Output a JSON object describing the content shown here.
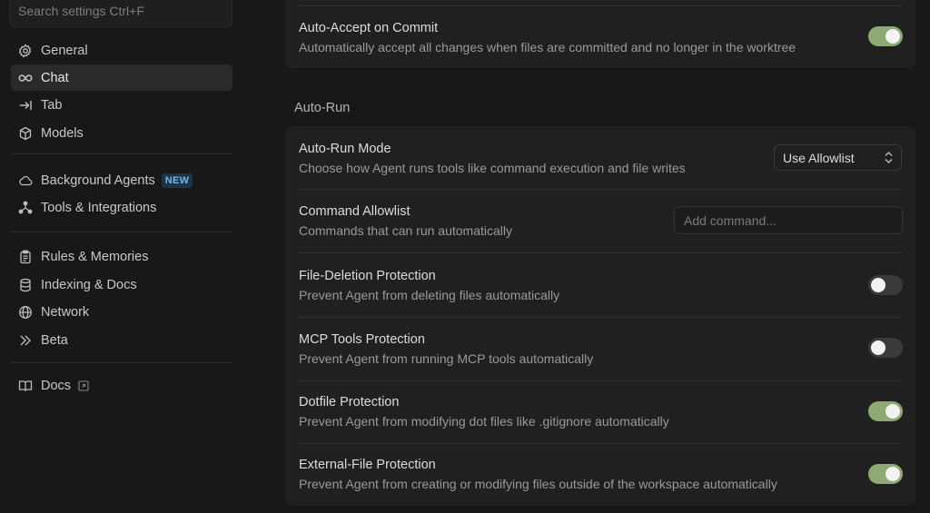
{
  "sidebar": {
    "search_placeholder": "Search settings Ctrl+F",
    "items": [
      {
        "label": "General",
        "icon": "gear-icon"
      },
      {
        "label": "Chat",
        "icon": "infinity-icon",
        "active": true
      },
      {
        "label": "Tab",
        "icon": "tab-arrow-icon"
      },
      {
        "label": "Models",
        "icon": "cube-icon"
      },
      {
        "label": "Background Agents",
        "icon": "cloud-icon",
        "badge": "NEW"
      },
      {
        "label": "Tools & Integrations",
        "icon": "nodes-icon"
      },
      {
        "label": "Rules & Memories",
        "icon": "clipboard-icon"
      },
      {
        "label": "Indexing & Docs",
        "icon": "database-icon"
      },
      {
        "label": "Network",
        "icon": "globe-icon"
      },
      {
        "label": "Beta",
        "icon": "double-chevron-icon"
      },
      {
        "label": "Docs",
        "icon": "book-icon",
        "external": true
      }
    ]
  },
  "top_card": {
    "title": "Auto-Accept on Commit",
    "description": "Automatically accept all changes when files are committed and no longer in the worktree",
    "enabled": true
  },
  "auto_run": {
    "section_title": "Auto-Run",
    "mode": {
      "title": "Auto-Run Mode",
      "description": "Choose how Agent runs tools like command execution and file writes",
      "selected": "Use Allowlist"
    },
    "allowlist": {
      "title": "Command Allowlist",
      "description": "Commands that can run automatically",
      "placeholder": "Add command..."
    },
    "file_deletion": {
      "title": "File-Deletion Protection",
      "description": "Prevent Agent from deleting files automatically",
      "enabled": false
    },
    "mcp_tools": {
      "title": "MCP Tools Protection",
      "description": "Prevent Agent from running MCP tools automatically",
      "enabled": false
    },
    "dotfile": {
      "title": "Dotfile Protection",
      "description": "Prevent Agent from modifying dot files like .gitignore automatically",
      "enabled": true
    },
    "external_file": {
      "title": "External-File Protection",
      "description": "Prevent Agent from creating or modifying files outside of the workspace automatically",
      "enabled": true
    }
  },
  "colors": {
    "accent_toggle_on": "#8fa972",
    "badge_text": "#6fb7e6",
    "background": "#181818",
    "card": "#202020"
  }
}
